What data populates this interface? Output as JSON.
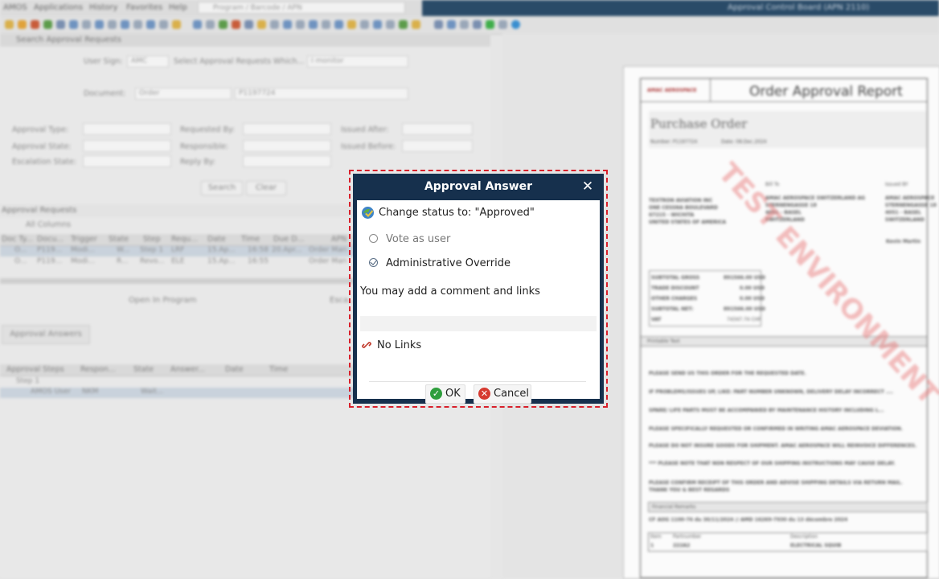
{
  "background": {
    "menu": [
      "AMOS",
      "Applications",
      "History",
      "Favorites",
      "Help"
    ],
    "path_placeholder": "Program / Barcode / APN",
    "window_title": "Approval Control Board (APN 2110)",
    "search_panel_title": "Search Approval Requests",
    "user_sign_label": "User Sign:",
    "user_sign_value": "AMC",
    "select_label": "Select Approval Requests Which...",
    "select_value": "I monitor",
    "document_label": "Document:",
    "document_type": "Order",
    "document_number": "P1197724",
    "filter_labels": [
      "Approval Type:",
      "Approval State:",
      "Escalation State:",
      "Requested By:",
      "Responsible:",
      "Reply By:",
      "Issued After:",
      "Issued Before:"
    ],
    "search_button": "Search",
    "clear_button": "Clear",
    "requests_title": "Approval Requests",
    "all_columns": "All Columns",
    "request_columns": [
      "Doc Ty...",
      "Docu...",
      "Trigger",
      "State",
      "Step",
      "Requ...",
      "Date",
      "Time",
      "Due D...",
      "APN"
    ],
    "request_rows": [
      [
        "O...",
        "P119...",
        "Modi...",
        "W...",
        "Step 1",
        "LRF",
        "15.Ap...",
        "16:58",
        "20.Apr...",
        "Order Man"
      ],
      [
        "O...",
        "P119...",
        "Modi...",
        "R...",
        "Revo...",
        "ELE",
        "15.Ap...",
        "16:55",
        "",
        "Order Man"
      ]
    ],
    "open_in_program": "Open In Program",
    "escalate": "Esca...",
    "answers_tab": "Approval Answers",
    "answer_columns": [
      "Approval Steps",
      "Respon...",
      "State",
      "Answer...",
      "Date",
      "Time"
    ],
    "answer_rows": [
      [
        "Step 1",
        "",
        "",
        "",
        "",
        ""
      ],
      [
        "AMOS User",
        "NKM",
        "Wait...",
        "",
        "",
        ""
      ]
    ]
  },
  "document_preview": {
    "logo_text": "AMAC AEROSPACE",
    "report_title": "Order Approval Report",
    "doc_heading": "Purchase Order",
    "number_line": "Number: P1197724",
    "date_line": "Date: 08.Dec.2024",
    "vendor": [
      "TEXTRON AVIATION INC",
      "ONE CESSNA BOULEVARD",
      "67215 - WICHITA",
      "UNITED STATES OF AMERICA"
    ],
    "bill_to_label": "Bill To",
    "bill_to": [
      "AMAC AEROSPACE SWITZERLAND AG",
      "STERNENGASSE 18",
      "4051 - BASEL",
      "SWITZERLAND"
    ],
    "issued_by_label": "Issued BY",
    "issued_by": [
      "AMAC AEROSPACE",
      "STERNENGASSE 18",
      "4051 - BASEL",
      "SWITZERLAND"
    ],
    "responsible": "Kevin Martin",
    "totals": [
      [
        "SUBTOTAL GROSS",
        "891566.00 USD"
      ],
      [
        "TRADE DISCOUNT",
        "0.00 USD"
      ],
      [
        "OTHER CHARGES",
        "0.00 USD"
      ],
      [
        "SUBTOTAL NET:",
        "891566.00 USD"
      ],
      [
        "VAT",
        "74347.74 CHF"
      ]
    ],
    "printable_text": "Printable Text",
    "notes": [
      "PLEASE SEND US THIS ORDER FOR THE REQUESTED DATE.",
      "IF PROBLEMS/ISSUES UP, LIKE: PART NUMBER UNKNOWN, DELIVERY DELAY INCORRECT ....",
      "SPARE/ LIFE PARTS MUST BE ACCOMPANIED BY MAINTENANCE HISTORY INCLUDING L...",
      "PLEASE SPECIFICALLY REQUESTED OR CONFIRMED IN WRITING AMAC AEROSPACE DEVIATION.",
      "PLEASE DO NOT INSURE GOODS FOR SHIPMENT. AMAC AEROSPACE WILL REINVOICE DIFFERENCES.",
      "*** PLEASE NOTE THAT NON RESPECT OF OUR SHIPPING INSTRUCTIONS MAY CAUSE DELAY.",
      "PLEASE CONFIRM RECEIPT OF THIS ORDER AND ADVISE SHIPPING DETAILS VIA RETURN MAIL.",
      "THANK YOU & BEST REGARDS"
    ],
    "financial_remarks": "Financial Remarks",
    "remark_line": "CF AOG 1100-76 du 30/11/2024 // AMD 16269-7930 du 13 décembre 2024",
    "item_headers": [
      "Item",
      "Partnumber",
      "Description"
    ],
    "item_row": [
      "1",
      "222A2",
      "ELECTRICAL SQUIB"
    ],
    "watermark": "TEST ENVIRONMENT"
  },
  "dialog": {
    "title": "Approval Answer",
    "close_glyph": "✕",
    "status_line": "Change status to: \"Approved\"",
    "option_vote": "Vote as user",
    "option_override": "Administrative Override",
    "comment_label": "You may add a comment and links",
    "comment_value": "",
    "links_text": "No Links",
    "ok_label": "OK",
    "cancel_label": "Cancel",
    "icons": [
      "status-change-icon",
      "radio-unselected-icon",
      "radio-selected-icon",
      "link-icon",
      "check-icon",
      "cancel-icon"
    ],
    "colors": {
      "title_bar": "#16304d",
      "highlight": "#d8202b",
      "ok_icon": "#2e9e3c",
      "cancel_icon": "#d63a30"
    }
  }
}
